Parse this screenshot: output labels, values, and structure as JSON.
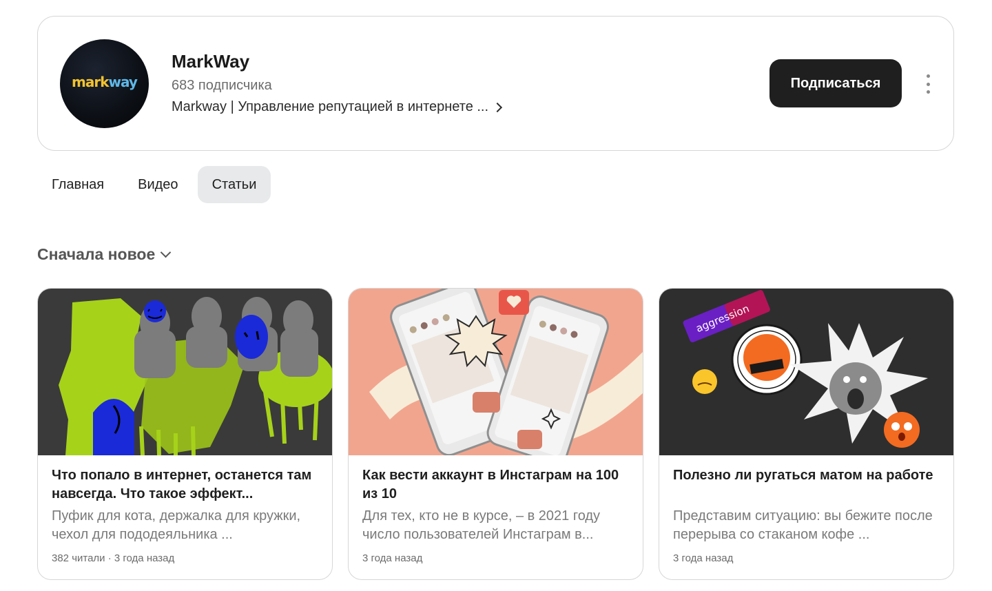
{
  "channel": {
    "avatar_text_part1": "mark",
    "avatar_text_part2": "way",
    "name": "MarkWay",
    "subscribers": "683 подписчика",
    "description": "Markway | Управление репутацией в интернете ...",
    "subscribe_label": "Подписаться"
  },
  "tabs": [
    {
      "label": "Главная",
      "active": false
    },
    {
      "label": "Видео",
      "active": false
    },
    {
      "label": "Статьи",
      "active": true
    }
  ],
  "sort": {
    "label": "Сначала новое"
  },
  "articles": [
    {
      "title": "Что попало в интернет, останется там навсегда. Что такое эффект...",
      "snippet": "Пуфик для кота, держалка для кружки, чехол для пододеяльника ...",
      "meta": "382 читали · 3 года назад"
    },
    {
      "title": "Как вести аккаунт в Инстаграм на 100 из 10",
      "snippet": "Для тех, кто не в курсе, – в 2021 году число пользователей Инстаграм в...",
      "meta": "3 года назад"
    },
    {
      "title": "Полезно ли ругаться матом на работе",
      "snippet": "Представим ситуацию: вы бежите после перерыва со стаканом кофе ...",
      "meta": "3 года назад",
      "sticker_text": "aggression"
    }
  ],
  "colors": {
    "subscribe_bg": "#1f1f1f",
    "active_tab_bg": "#e8e9eb",
    "card1_bg": "#3a3a3a",
    "card1_accent": "#a6d21a",
    "card2_bg": "#f2a58e",
    "card3_bg": "#2e2e2e"
  }
}
